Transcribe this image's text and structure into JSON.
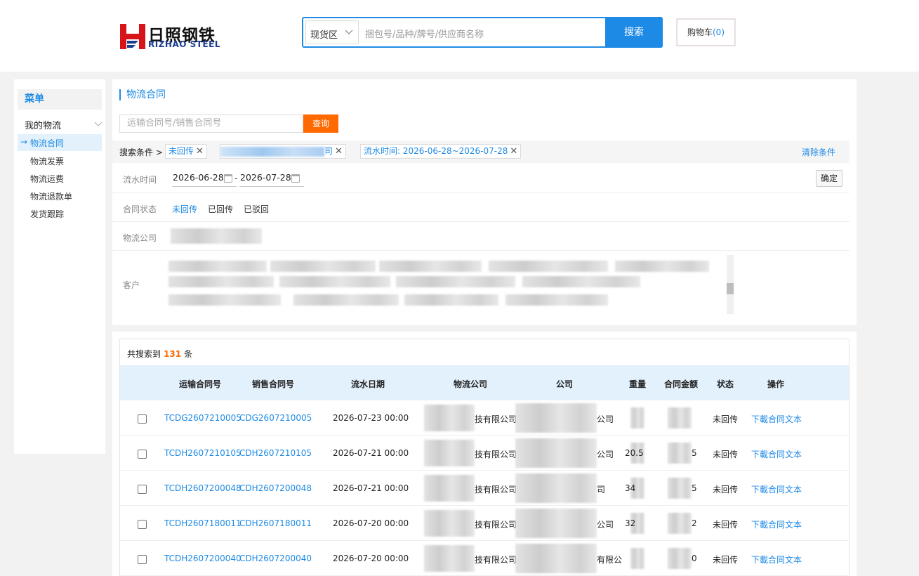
{
  "header": {
    "logo_cn": "日照钢铁",
    "logo_en": "RIZHAO STEEL",
    "zone_select": "现货区",
    "search_placeholder": "捆包号/品种/牌号/供应商名称",
    "search_button": "搜索",
    "cart_label": "购物车",
    "cart_count": "(0)"
  },
  "sidebar": {
    "title": "菜单",
    "group": "我的物流",
    "items": [
      {
        "label": "物流合同",
        "active": true
      },
      {
        "label": "物流发票"
      },
      {
        "label": "物流运费"
      },
      {
        "label": "物流退款单"
      },
      {
        "label": "发货跟踪"
      }
    ]
  },
  "filter": {
    "title": "物流合同",
    "query_placeholder": "运输合同号/销售合同号",
    "query_button": "查询",
    "conditions_label": "搜索条件 >",
    "chips": [
      {
        "text": "未回传"
      },
      {
        "text": "司"
      },
      {
        "text": "流水时间: 2026-06-28~2026-07-28"
      }
    ],
    "clear_label": "清除条件",
    "date_label": "流水时间",
    "date_from": "2026-06-28",
    "date_sep": "-",
    "date_to": "2026-07-28",
    "confirm_button": "确定",
    "status_label": "合同状态",
    "status_options": [
      "未回传",
      "已回传",
      "已驳回"
    ],
    "company_label": "物流公司",
    "customer_label": "客户"
  },
  "results": {
    "prefix": "共搜索到",
    "count": "131",
    "suffix": "条",
    "columns": [
      "运输合同号",
      "销售合同号",
      "流水日期",
      "物流公司",
      "公司",
      "重量",
      "合同金额",
      "状态",
      "操作"
    ],
    "rows": [
      {
        "transport_no": "TCDG2607210005",
        "sales_no": "CDG2607210005",
        "date": "2026-07-23 00:00",
        "logistics": "技有限公司",
        "company": "公司",
        "weight": "",
        "amount": "",
        "status": "未回传",
        "action": "下載合同文本"
      },
      {
        "transport_no": "TCDH2607210105",
        "sales_no": "CDH2607210105",
        "date": "2026-07-21 00:00",
        "logistics": "技有限公司",
        "company": "公司",
        "weight": "20.5",
        "amount": "5",
        "status": "未回传",
        "action": "下載合同文本"
      },
      {
        "transport_no": "TCDH2607200048",
        "sales_no": "CDH2607200048",
        "date": "2026-07-21 00:00",
        "logistics": "技有限公司",
        "company": "司",
        "weight": "34",
        "amount": "5",
        "status": "未回传",
        "action": "下載合同文本"
      },
      {
        "transport_no": "TCDH2607180011",
        "sales_no": "CDH2607180011",
        "date": "2026-07-20 00:00",
        "logistics": "技有限公司",
        "company": "公司",
        "weight": "32",
        "amount": "2",
        "status": "未回传",
        "action": "下載合同文本"
      },
      {
        "transport_no": "TCDH2607200040",
        "sales_no": "CDH2607200040",
        "date": "2026-07-20 00:00",
        "logistics": "技有限公司",
        "company": "有限公",
        "weight": "",
        "amount": "0",
        "status": "未回传",
        "action": "下載合同文本"
      }
    ]
  },
  "colors": {
    "accent": "#1d8ae5",
    "orange": "#ff6a00",
    "logo_red": "#d7141a",
    "logo_blue": "#1a3d8f"
  }
}
